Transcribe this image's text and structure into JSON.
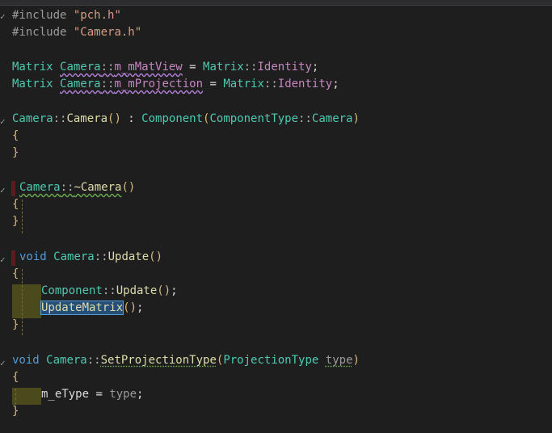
{
  "code": {
    "l1": [
      "#include",
      " ",
      "\"pch.h\""
    ],
    "l2": [
      "#include",
      " ",
      "\"Camera.h\""
    ],
    "l4": [
      "Matrix",
      " ",
      "Camera",
      "::",
      "m_mMatView",
      " = ",
      "Matrix",
      "::",
      "Identity",
      ";"
    ],
    "l5": [
      "Matrix",
      " ",
      "Camera",
      "::",
      "m_mProjection",
      " = ",
      "Matrix",
      "::",
      "Identity",
      ";"
    ],
    "l7": [
      "Camera",
      "::",
      "Camera",
      "()",
      " : ",
      "Component",
      "(",
      "ComponentType",
      "::",
      "Camera",
      ")"
    ],
    "l8": [
      "{"
    ],
    "l9": [
      "}"
    ],
    "l11": [
      "Camera",
      "::",
      "~Camera",
      "()"
    ],
    "l12": [
      "{"
    ],
    "l13": [
      "}"
    ],
    "l15": [
      "void",
      " ",
      "Camera",
      "::",
      "Update",
      "()"
    ],
    "l16": [
      "{"
    ],
    "l17": [
      "Component",
      "::",
      "Update",
      "()",
      ";"
    ],
    "l18": [
      "UpdateMatrix",
      "()",
      ";"
    ],
    "l19": [
      "}"
    ],
    "l21": [
      "void",
      " ",
      "Camera",
      "::",
      "SetProjectionType",
      "(",
      "ProjectionType",
      " ",
      "type",
      ")"
    ],
    "l22": [
      "{"
    ],
    "l23": [
      "m_eType",
      " = ",
      "type",
      ";"
    ],
    "l24": [
      "}"
    ]
  },
  "colors": {
    "background": "#1e1e1e",
    "keyword": "#569cd6",
    "type": "#4ec9b0",
    "static_member": "#c586c0",
    "function": "#dcdcaa",
    "string": "#d69d85",
    "brace": "#d7ba7d"
  }
}
